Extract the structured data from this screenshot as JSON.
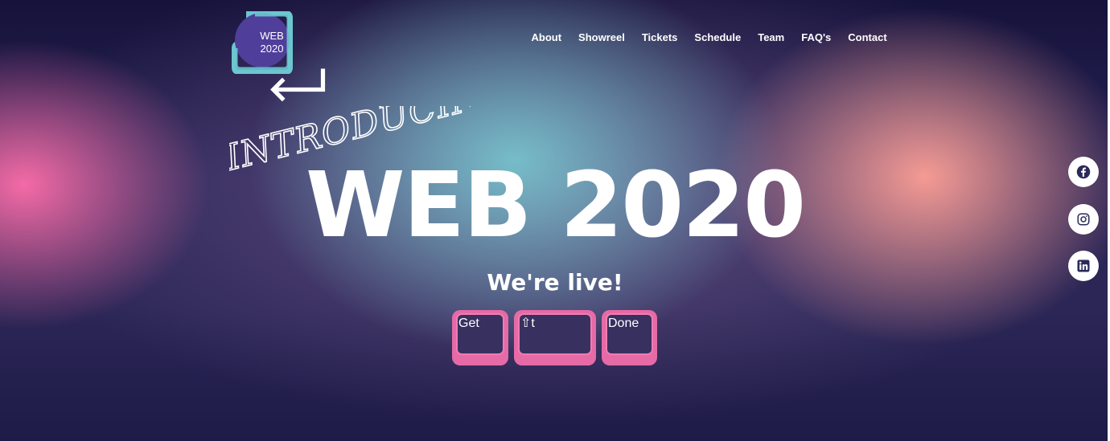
{
  "logo": {
    "line1": "WEB",
    "line2": "2020",
    "icon": "enter-arrow-icon"
  },
  "nav": {
    "items": [
      "About",
      "Showreel",
      "Tickets",
      "Schedule",
      "Team",
      "FAQ's",
      "Contact"
    ]
  },
  "hero": {
    "kicker": "INTRODUCING",
    "headline": "WEB 2020",
    "tagline": "We're live!",
    "keys": [
      "Get",
      "⇧t",
      "Done"
    ]
  },
  "social": [
    "facebook-icon",
    "instagram-icon",
    "linkedin-icon"
  ],
  "colors": {
    "accent_pink": "#e56aa6",
    "dark_navy": "#1f1c48",
    "logo_purple": "#4f3f9a",
    "logo_teal": "#6cc6cf"
  }
}
